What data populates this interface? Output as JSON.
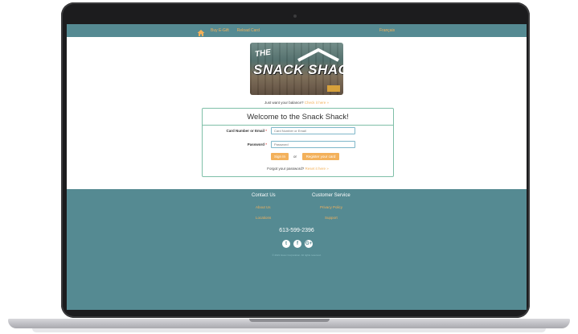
{
  "nav": {
    "links": [
      "Buy E-Gift",
      "Reload Card"
    ],
    "language": "Français"
  },
  "hero": {
    "the": "THE",
    "name": "SNACK SHACK"
  },
  "balance": {
    "prompt": "Just want your balance?",
    "link": "Check it here »"
  },
  "login": {
    "title": "Welcome to the Snack Shack!",
    "card_label": "Card Number or Email",
    "card_placeholder": "Card Number or Email",
    "password_label": "Password",
    "password_placeholder": "Password",
    "required_mark": "*",
    "sign_in": "Sign In",
    "or": "or",
    "register": "Register your card",
    "forgot_prompt": "Forgot your password?",
    "forgot_link": "Reset it here »"
  },
  "footer": {
    "contact_heading": "Contact Us",
    "service_heading": "Customer Service",
    "about": "About Us",
    "locations": "Locations",
    "privacy": "Privacy Policy",
    "support": "Support",
    "phone": "613-599-2396",
    "social": [
      "t",
      "f",
      "G+"
    ],
    "copyright": "© 2021 Givex Corporation. All rights reserved."
  },
  "colors": {
    "teal": "#558a92",
    "accent": "#f3b15b"
  }
}
